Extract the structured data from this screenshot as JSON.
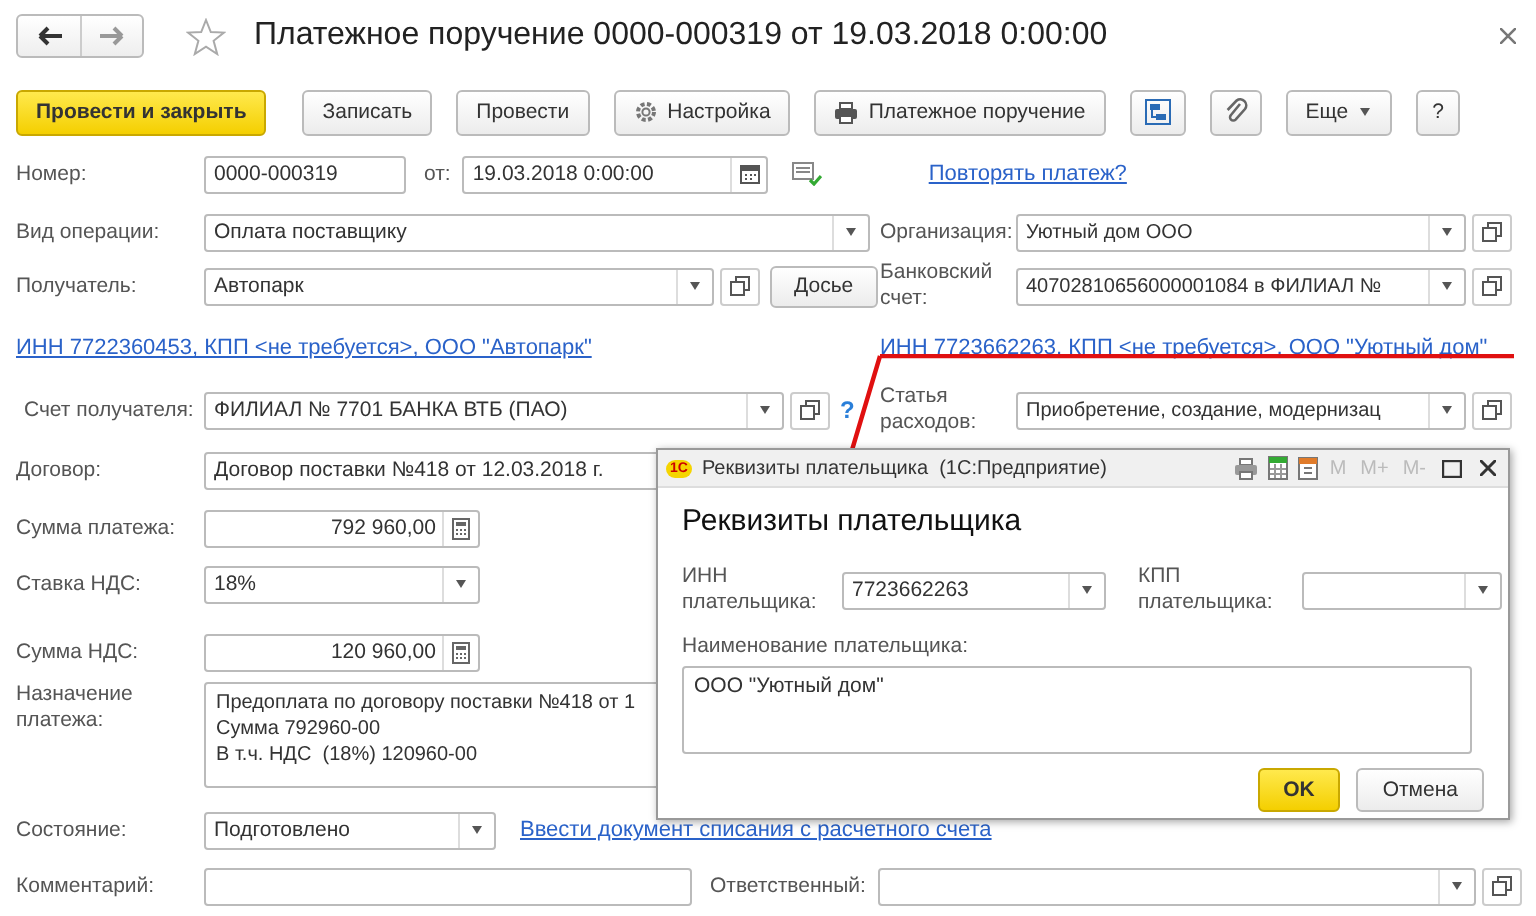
{
  "window": {
    "title": "Платежное поручение 0000-000319 от 19.03.2018 0:00:00"
  },
  "toolbar": [
    {
      "label": "Провести и закрыть",
      "kind": "primary"
    },
    {
      "label": "Записать",
      "kind": "plain"
    },
    {
      "label": "Провести",
      "kind": "plain"
    },
    {
      "label": "Настройка",
      "kind": "settings"
    },
    {
      "label": "Платежное поручение",
      "kind": "print"
    },
    {
      "kind": "structure"
    },
    {
      "kind": "attach"
    },
    {
      "label": "Еще",
      "kind": "menu"
    },
    {
      "label": "?",
      "kind": "plain"
    }
  ],
  "number": {
    "label": "Номер:",
    "value": "0000-000319"
  },
  "date": {
    "label": "от:",
    "value": "19.03.2018  0:00:00"
  },
  "repeat_link": "Повторять платеж?",
  "operation": {
    "label": "Вид операции:",
    "value": "Оплата поставщику"
  },
  "organization": {
    "label": "Организация:",
    "value": "Уютный дом ООО"
  },
  "recipient": {
    "label": "Получатель:",
    "value": "Автопарк",
    "button": "Досье"
  },
  "bank_account": {
    "label": "Банковский счет:",
    "value": "40702810656000001084 в ФИЛИАЛ №"
  },
  "recipient_info_link": "ИНН 7722360453, КПП <не требуется>, ООО \"Автопарк\"",
  "payer_info_link": "ИНН 7723662263, КПП <не требуется>, ООО \"Уютный дом\"",
  "recipient_account": {
    "label": "Счет получателя:",
    "value": "ФИЛИАЛ № 7701 БАНКА ВТБ (ПАО)",
    "help": "?"
  },
  "expense_item": {
    "label": "Статья расходов:",
    "value": "Приобретение, создание, модернизац"
  },
  "contract": {
    "label": "Договор:",
    "value": "Договор поставки №418 от 12.03.2018 г."
  },
  "payment_sum": {
    "label": "Сумма платежа:",
    "value": "792 960,00"
  },
  "vat_rate": {
    "label": "Ставка НДС:",
    "value": "18%"
  },
  "vat_sum": {
    "label": "Сумма НДС:",
    "value": "120 960,00"
  },
  "purpose": {
    "label": "Назначение платежа:",
    "lines": [
      "Предоплата по договору поставки №418 от 1",
      "Сумма 792960-00",
      "В т.ч. НДС  (18%) 120960-00"
    ]
  },
  "state": {
    "label": "Состояние:",
    "value": "Подготовлено"
  },
  "writeoff_link": "Ввести документ списания с расчетного счета",
  "comment": {
    "label": "Комментарий:"
  },
  "responsible": {
    "label": "Ответственный:"
  },
  "dialog": {
    "title": "Реквизиты плательщика  (1С:Предприятие)",
    "logo": "1С",
    "tools": [
      "M",
      "M+",
      "M-"
    ],
    "heading": "Реквизиты плательщика",
    "inn": {
      "label": "ИНН плательщика:",
      "value": "7723662263"
    },
    "kpp": {
      "label": "КПП плательщика:"
    },
    "name": {
      "label": "Наименование плательщика:",
      "value": "ООО \"Уютный дом\""
    },
    "buttons": [
      {
        "label": "OK",
        "kind": "primary"
      },
      {
        "label": "Отмена",
        "kind": "plain"
      }
    ]
  }
}
